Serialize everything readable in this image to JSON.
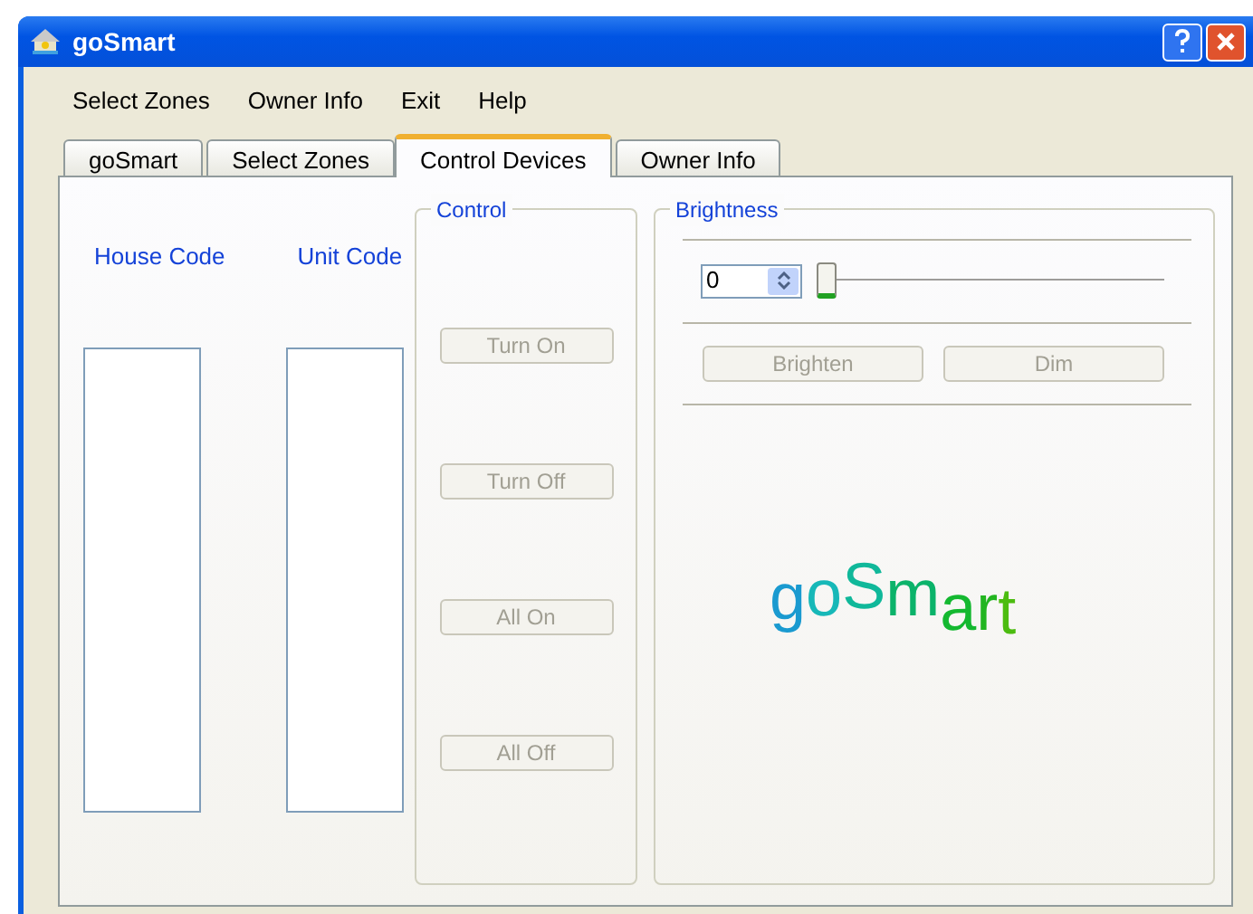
{
  "window": {
    "title": "goSmart"
  },
  "menu": [
    "Select Zones",
    "Owner Info",
    "Exit",
    "Help"
  ],
  "tabs": [
    {
      "label": "goSmart",
      "selected": false
    },
    {
      "label": "Select Zones",
      "selected": false
    },
    {
      "label": "Control Devices",
      "selected": true
    },
    {
      "label": "Owner Info",
      "selected": false
    }
  ],
  "lists": [
    {
      "label": "House Code"
    },
    {
      "label": "Unit Code"
    }
  ],
  "control": {
    "title": "Control",
    "buttons": [
      {
        "label": "Turn On",
        "disabled": true
      },
      {
        "label": "Turn Off",
        "disabled": true
      },
      {
        "label": "All On",
        "disabled": true
      },
      {
        "label": "All Off",
        "disabled": true
      }
    ]
  },
  "brightness": {
    "title": "Brightness",
    "spinner_value": "0",
    "slider": {
      "level": 0
    },
    "buttons": [
      {
        "label": "Brighten",
        "disabled": true
      },
      {
        "label": "Dim",
        "disabled": true
      }
    ]
  },
  "logo": "goSmart"
}
